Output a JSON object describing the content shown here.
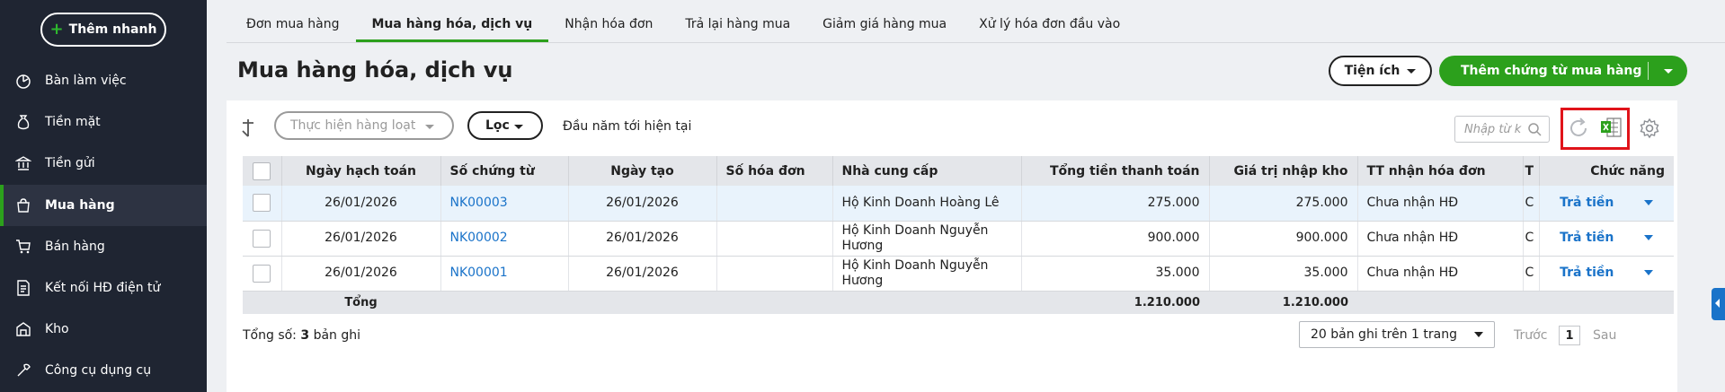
{
  "sidebar": {
    "quick_add_label": "Thêm nhanh",
    "items": [
      {
        "label": "Bàn làm việc",
        "icon": "dashboard-icon"
      },
      {
        "label": "Tiền mặt",
        "icon": "money-bag-icon"
      },
      {
        "label": "Tiền gửi",
        "icon": "bank-icon"
      },
      {
        "label": "Mua hàng",
        "icon": "shopping-bag-icon",
        "active": true
      },
      {
        "label": "Bán hàng",
        "icon": "cart-icon"
      },
      {
        "label": "Kết nối HĐ điện tử",
        "icon": "e-invoice-icon"
      },
      {
        "label": "Kho",
        "icon": "warehouse-icon"
      },
      {
        "label": "Công cụ dụng cụ",
        "icon": "tools-icon"
      }
    ]
  },
  "tabs": [
    "Đơn mua hàng",
    "Mua hàng hóa, dịch vụ",
    "Nhận hóa đơn",
    "Trả lại hàng mua",
    "Giảm giá hàng mua",
    "Xử lý hóa đơn đầu vào"
  ],
  "active_tab": "Mua hàng hóa, dịch vụ",
  "page_title": "Mua hàng hóa, dịch vụ",
  "header": {
    "utility_label": "Tiện ích",
    "add_label": "Thêm chứng từ mua hàng"
  },
  "toolbar": {
    "batch_placeholder": "Thực hiện hàng loạt",
    "filter_label": "Lọc",
    "period_text": "Đầu năm tới hiện tại",
    "search_placeholder": "Nhập từ k"
  },
  "table": {
    "columns": [
      "Ngày hạch toán",
      "Số chứng từ",
      "Ngày tạo",
      "Số hóa đơn",
      "Nhà cung cấp",
      "Tổng tiền thanh toán",
      "Giá trị nhập kho",
      "TT nhận hóa đơn",
      "T",
      "Chức năng"
    ],
    "rows": [
      {
        "posting_date": "26/01/2026",
        "voucher_no": "NK00003",
        "created_date": "26/01/2026",
        "invoice_no": "",
        "supplier": "Hộ Kinh Doanh Hoàng Lê",
        "total": "275.000",
        "stock_value": "275.000",
        "invoice_status": "Chưa nhận HĐ",
        "t": "C",
        "action": "Trả tiền"
      },
      {
        "posting_date": "26/01/2026",
        "voucher_no": "NK00002",
        "created_date": "26/01/2026",
        "invoice_no": "",
        "supplier": "Hộ Kinh Doanh Nguyễn Hương",
        "total": "900.000",
        "stock_value": "900.000",
        "invoice_status": "Chưa nhận HĐ",
        "t": "C",
        "action": "Trả tiền"
      },
      {
        "posting_date": "26/01/2026",
        "voucher_no": "NK00001",
        "created_date": "26/01/2026",
        "invoice_no": "",
        "supplier": "Hộ Kinh Doanh Nguyễn Hương",
        "total": "35.000",
        "stock_value": "35.000",
        "invoice_status": "Chưa nhận HĐ",
        "t": "C",
        "action": "Trả tiền"
      }
    ],
    "totals": {
      "label": "Tổng",
      "total": "1.210.000",
      "stock_value": "1.210.000"
    }
  },
  "footer": {
    "count_prefix": "Tổng số:",
    "count_value": "3",
    "count_suffix": "bản ghi",
    "page_size": "20 bản ghi trên 1 trang",
    "prev": "Trước",
    "page": "1",
    "next": "Sau"
  },
  "colors": {
    "brand_green": "#2ca01c",
    "link_blue": "#1a73c9",
    "sidebar_bg": "#1f2532",
    "highlight_red": "#e0131a"
  }
}
